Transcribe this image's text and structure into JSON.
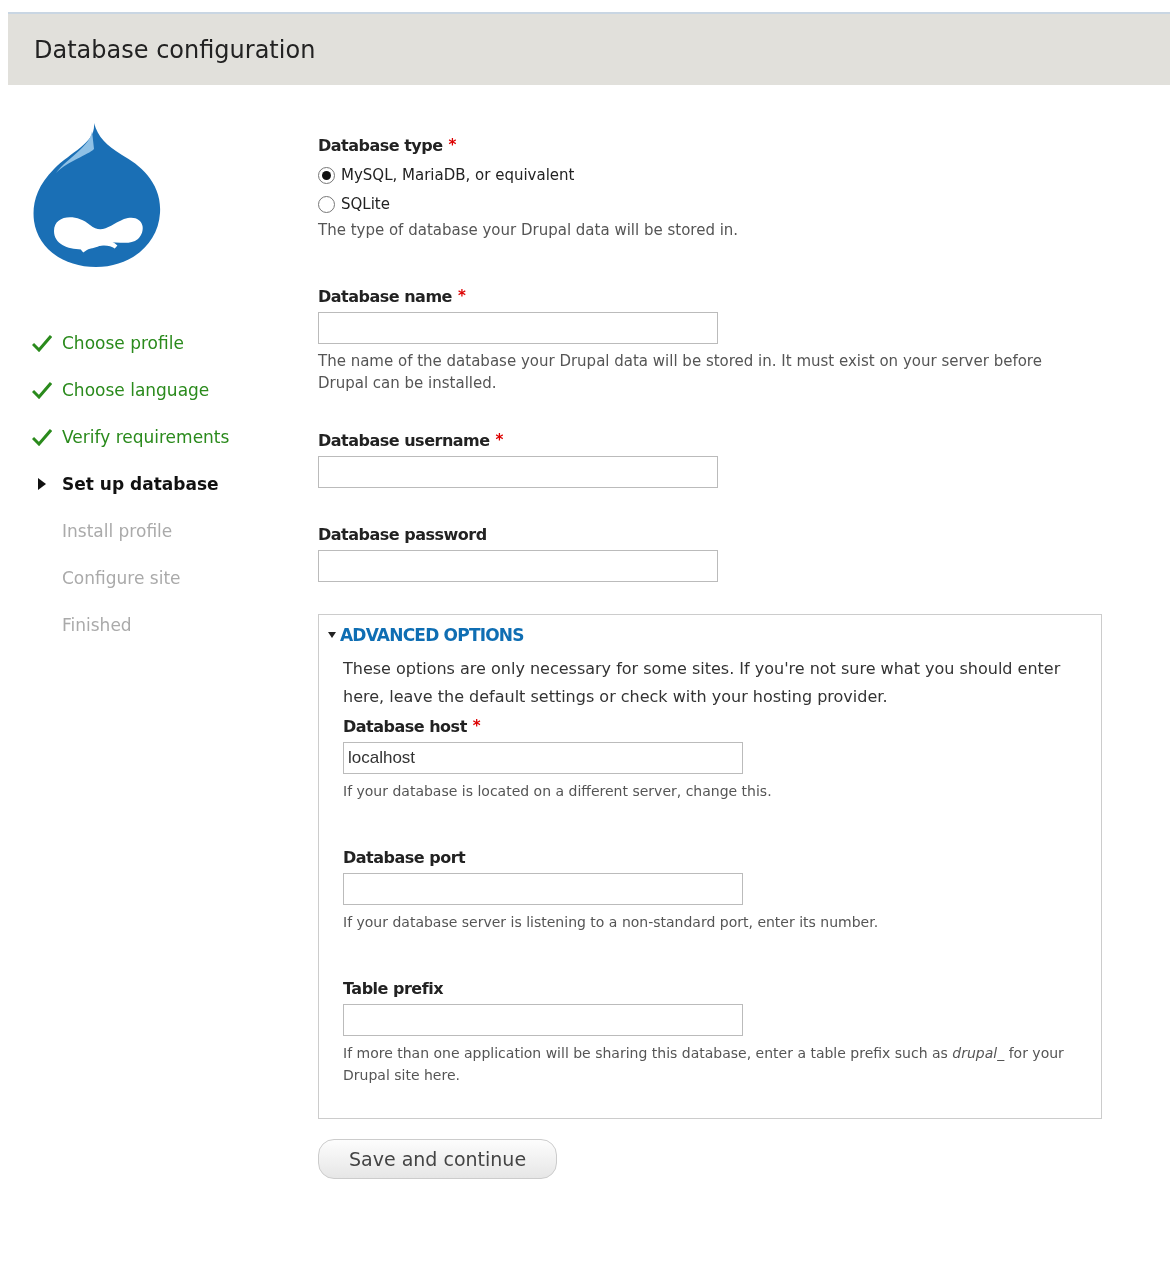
{
  "page": {
    "title": "Database configuration"
  },
  "steps": [
    {
      "label": "Choose profile",
      "completed": true,
      "current": false
    },
    {
      "label": "Choose language",
      "completed": true,
      "current": false
    },
    {
      "label": "Verify requirements",
      "completed": true,
      "current": false
    },
    {
      "label": "Set up database",
      "completed": false,
      "current": true
    },
    {
      "label": "Install profile",
      "completed": false,
      "current": false
    },
    {
      "label": "Configure site",
      "completed": false,
      "current": false
    },
    {
      "label": "Finished",
      "completed": false,
      "current": false
    }
  ],
  "database_type": {
    "label": "Database type",
    "required_mark": "*",
    "options": [
      {
        "label": "MySQL, MariaDB, or equivalent",
        "selected": true
      },
      {
        "label": "SQLite",
        "selected": false
      }
    ],
    "description": "The type of database your Drupal data will be stored in."
  },
  "fields": [
    {
      "label": "Database name",
      "required_mark": "*",
      "description": "The name of the database your Drupal data will be stored in. It must exist on your server before Drupal can be installed."
    },
    {
      "label": "Database username",
      "required_mark": "*"
    },
    {
      "label": "Database password"
    }
  ],
  "advanced": {
    "title": "ADVANCED OPTIONS",
    "expanded": true,
    "intro": "These options are only necessary for some sites. If you're not sure what you should enter here, leave the default settings or check with your hosting provider.",
    "fields": [
      {
        "label": "Database host",
        "required_mark": "*",
        "value": "localhost",
        "description": "If your database is located on a different server, change this."
      },
      {
        "label": "Database port",
        "description": "If your database server is listening to a non-standard port, enter its number."
      },
      {
        "label": "Table prefix",
        "description": "If more than one application will be sharing this database, enter a table prefix such as *drupal_* for your Drupal site here."
      }
    ]
  },
  "submit": {
    "label": "Save and continue"
  }
}
